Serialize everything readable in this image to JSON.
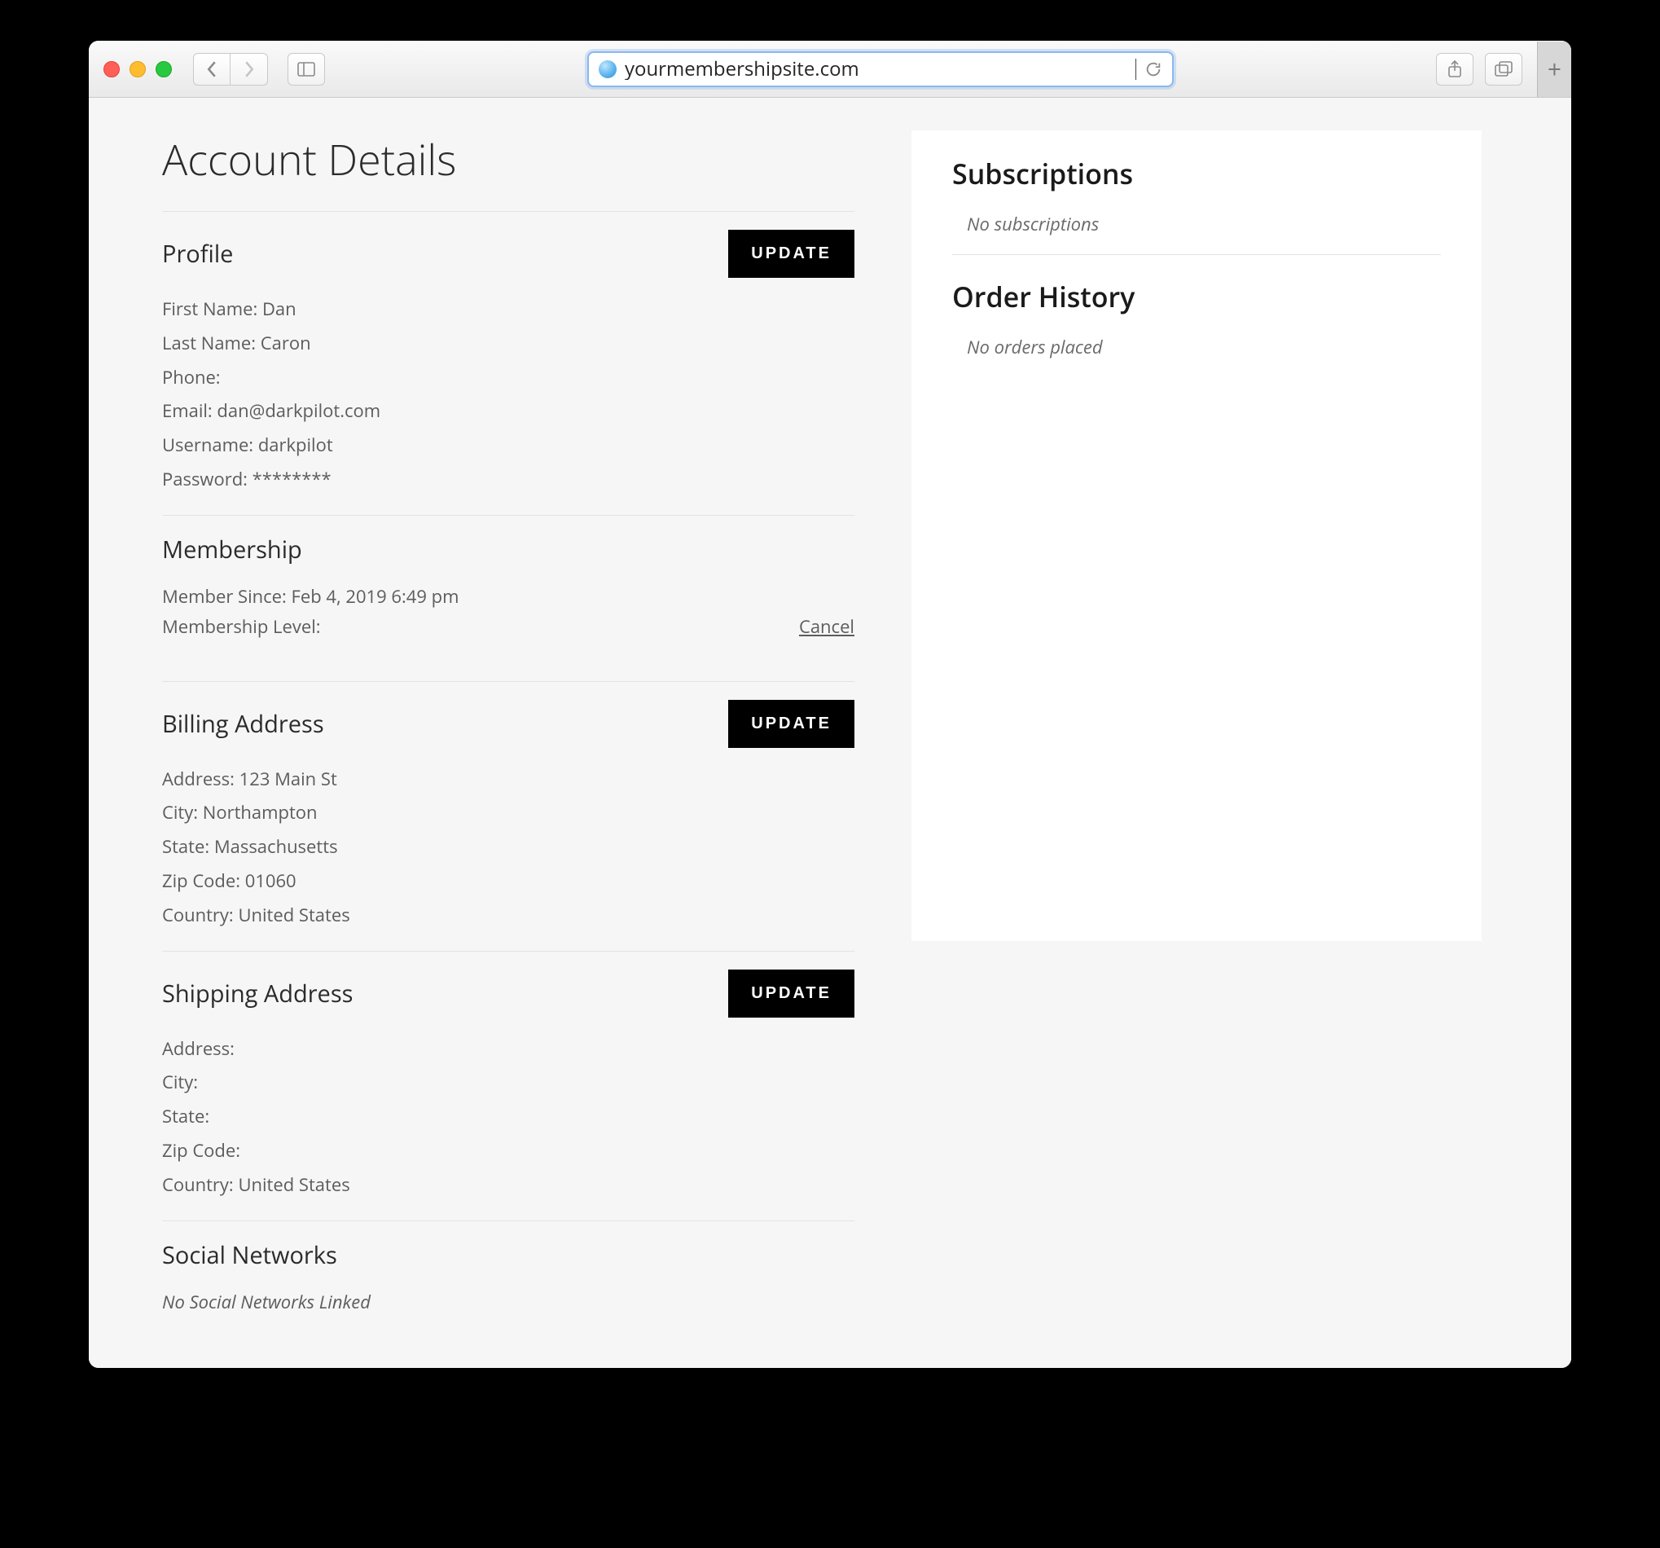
{
  "browser": {
    "url": "yourmembershipsite.com"
  },
  "page": {
    "title": "Account Details",
    "profile": {
      "heading": "Profile",
      "button": "UPDATE",
      "labels": {
        "first_name": "First Name:",
        "last_name": "Last Name:",
        "phone": "Phone:",
        "email": "Email:",
        "username": "Username:",
        "password": "Password:"
      },
      "values": {
        "first_name": "Dan",
        "last_name": "Caron",
        "phone": "",
        "email": "dan@darkpilot.com",
        "username": "darkpilot",
        "password": "********"
      }
    },
    "membership": {
      "heading": "Membership",
      "since_label": "Member Since:",
      "since_value": "Feb 4, 2019 6:49 pm",
      "level_label": "Membership Level:",
      "level_value": "",
      "cancel": "Cancel"
    },
    "billing": {
      "heading": "Billing Address",
      "button": "UPDATE",
      "labels": {
        "address": "Address:",
        "city": "City:",
        "state": "State:",
        "zip": "Zip Code:",
        "country": "Country:"
      },
      "values": {
        "address": "123 Main St",
        "city": "Northampton",
        "state": "Massachusetts",
        "zip": "01060",
        "country": "United States"
      }
    },
    "shipping": {
      "heading": "Shipping Address",
      "button": "UPDATE",
      "labels": {
        "address": "Address:",
        "city": "City:",
        "state": "State:",
        "zip": "Zip Code:",
        "country": "Country:"
      },
      "values": {
        "address": "",
        "city": "",
        "state": "",
        "zip": "",
        "country": "United States"
      }
    },
    "social": {
      "heading": "Social Networks",
      "empty": "No Social Networks Linked"
    },
    "side": {
      "subscriptions_heading": "Subscriptions",
      "subscriptions_empty": "No subscriptions",
      "orders_heading": "Order History",
      "orders_empty": "No orders placed"
    }
  }
}
